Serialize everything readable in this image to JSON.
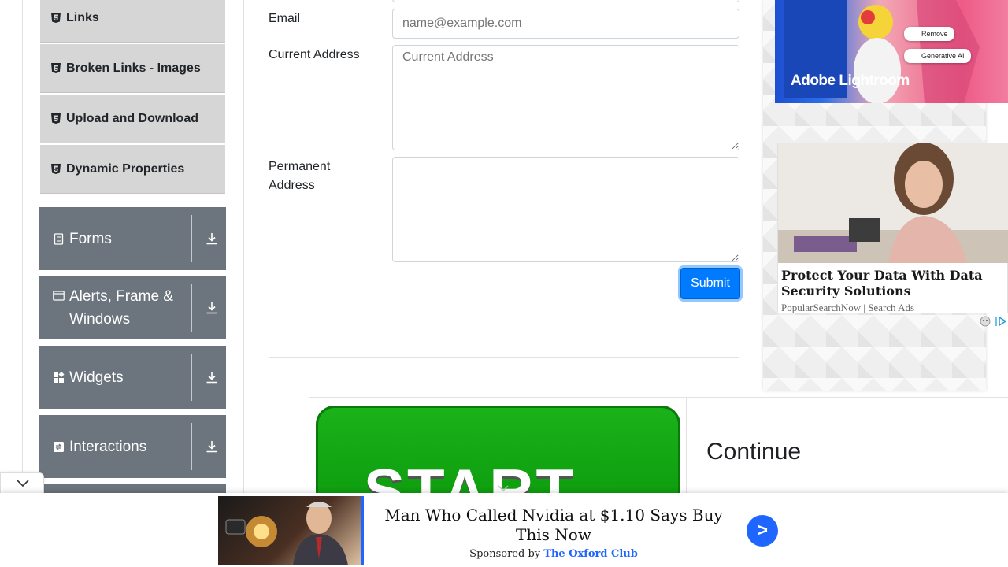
{
  "sidebar": {
    "sub_items": [
      {
        "label": "Links"
      },
      {
        "label": "Broken Links - Images"
      },
      {
        "label": "Upload and Download"
      },
      {
        "label": "Dynamic Properties"
      }
    ],
    "groups": [
      {
        "label": "Forms"
      },
      {
        "label": "Alerts, Frame & Windows"
      },
      {
        "label": "Widgets"
      },
      {
        "label": "Interactions"
      }
    ]
  },
  "form": {
    "email_label": "Email",
    "email_placeholder": "name@example.com",
    "current_address_label": "Current Address",
    "current_address_placeholder": "Current Address",
    "permanent_address_label": "Permanent Address",
    "submit_label": "Submit"
  },
  "ads": {
    "start_ad": {
      "button_text": "START",
      "cta": "Continue"
    },
    "lightroom": {
      "brand": "Adobe Lightroom",
      "chip_remove": "Remove",
      "chip_genai": "Generative AI"
    },
    "data_security": {
      "headline": "Protect Your Data With Data Security Solutions",
      "source": "PopularSearchNow | Search Ads"
    },
    "bottom": {
      "headline": "Man Who Called Nvidia at $1.10 Says Buy This Now",
      "sponsored_prefix": "Sponsored by",
      "sponsor": "The Oxford Club",
      "go": ">"
    }
  },
  "colors": {
    "sidebar_group_bg": "#6c757d",
    "sidebar_item_bg": "#d6d6d6",
    "primary": "#007bff"
  }
}
